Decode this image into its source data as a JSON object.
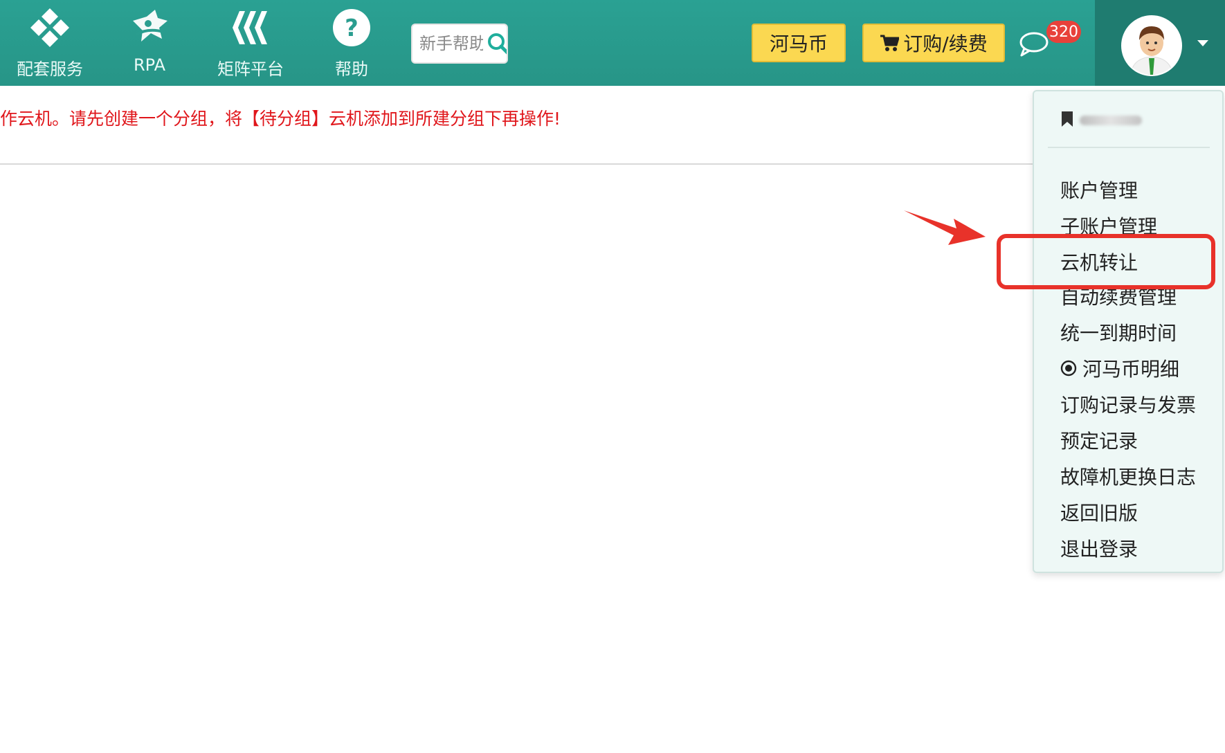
{
  "nav": {
    "items": [
      {
        "label": "配套服务",
        "icon": "diamond-grid-icon"
      },
      {
        "label": "RPA",
        "icon": "rpa-robot-icon"
      },
      {
        "label": "矩阵平台",
        "icon": "matrix-chevrons-icon"
      },
      {
        "label": "帮助",
        "icon": "help-circle-icon"
      }
    ],
    "search": {
      "placeholder": "新手帮助"
    }
  },
  "toolbar": {
    "coins_label": "河马币",
    "order_label": "订购/续费",
    "message_badge": "320"
  },
  "notice": {
    "text": "作云机。请先创建一个分组，将【待分组】云机添加到所建分组下再操作!"
  },
  "user_menu": {
    "items": [
      {
        "label": "账户管理"
      },
      {
        "label": "子账户管理"
      },
      {
        "label": "云机转让",
        "highlighted": true
      },
      {
        "label": "自动续费管理"
      },
      {
        "label": "统一到期时间"
      },
      {
        "label": "河马币明细",
        "icon": "coin-target-icon"
      },
      {
        "label": "订购记录与发票"
      },
      {
        "label": "预定记录"
      },
      {
        "label": "故障机更换日志"
      },
      {
        "label": "返回旧版"
      },
      {
        "label": "退出登录"
      }
    ]
  },
  "colors": {
    "topbar": "#2a9d8f",
    "user_area": "#1f7c70",
    "accent_yellow": "#fbd851",
    "notice_red": "#e0161b",
    "highlight_red": "#e8322a"
  }
}
